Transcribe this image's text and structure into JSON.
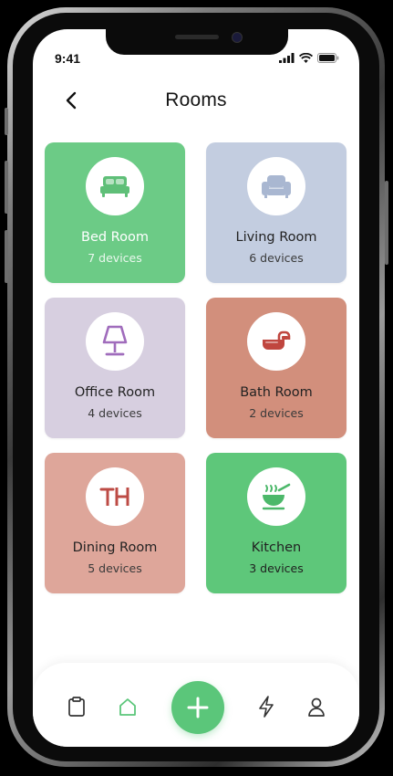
{
  "status_bar": {
    "time": "9:41"
  },
  "header": {
    "title": "Rooms"
  },
  "rooms": [
    {
      "name": "Bed Room",
      "count": "7 devices",
      "bg": "#6ccb86",
      "name_color": "#ffffff",
      "count_color": "#eaf8ee",
      "icon": "bed-icon",
      "icon_color": "#5fbf78"
    },
    {
      "name": "Living Room",
      "count": "6 devices",
      "bg": "#c3cde0",
      "name_color": "#222222",
      "count_color": "#3a3a3a",
      "icon": "sofa-icon",
      "icon_color": "#a9b7d1"
    },
    {
      "name": "Office Room",
      "count": "4 devices",
      "bg": "#d7cfe0",
      "name_color": "#222222",
      "count_color": "#3a3a3a",
      "icon": "lamp-icon",
      "icon_color": "#a06cbc"
    },
    {
      "name": "Bath Room",
      "count": "2 devices",
      "bg": "#d28f7c",
      "name_color": "#222222",
      "count_color": "#3a3a3a",
      "icon": "bathtub-icon",
      "icon_color": "#c0463f"
    },
    {
      "name": "Dining Room",
      "count": "5 devices",
      "bg": "#dea69a",
      "name_color": "#222222",
      "count_color": "#3a3a3a",
      "icon": "dining-table-icon",
      "icon_color": "#bd4b45"
    },
    {
      "name": "Kitchen",
      "count": "3 devices",
      "bg": "#5ec77a",
      "name_color": "#222222",
      "count_color": "#1f1f1f",
      "icon": "cooking-pot-icon",
      "icon_color": "#4cb86a"
    }
  ],
  "bottom_nav": {
    "items": [
      "clipboard-icon",
      "home-icon",
      "plus-icon",
      "lightning-icon",
      "user-icon"
    ],
    "active": "home-icon",
    "accent": "#5bc67a"
  }
}
